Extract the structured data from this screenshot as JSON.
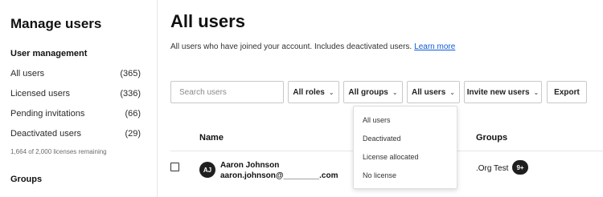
{
  "sidebar": {
    "title": "Manage users",
    "section": "User management",
    "items": [
      {
        "label": "All users",
        "count": "(365)"
      },
      {
        "label": "Licensed users",
        "count": "(336)"
      },
      {
        "label": "Pending invitations",
        "count": "(66)"
      },
      {
        "label": "Deactivated users",
        "count": "(29)"
      }
    ],
    "license_note": "1,664 of 2,000 licenses remaining",
    "groups_heading": "Groups"
  },
  "main": {
    "title": "All users",
    "subtitle": "All users who have joined your account. Includes deactivated users.",
    "learn_more": "Learn more"
  },
  "toolbar": {
    "search_placeholder": "Search users",
    "all_roles": "All roles",
    "all_groups": "All groups",
    "all_users": "All users",
    "invite": "Invite new users",
    "export": "Export"
  },
  "menu": {
    "items": [
      "All users",
      "Deactivated",
      "License allocated",
      "No license"
    ]
  },
  "table": {
    "headers": {
      "name": "Name",
      "groups": "Groups"
    },
    "rows": [
      {
        "initials": "AJ",
        "name": "Aaron Johnson",
        "email": "aaron.johnson@________.com",
        "group": ".Org Test",
        "group_badge": "9+"
      }
    ]
  },
  "colors": {
    "accent_link": "#0d5bd7",
    "dark": "#1f1f1f"
  }
}
